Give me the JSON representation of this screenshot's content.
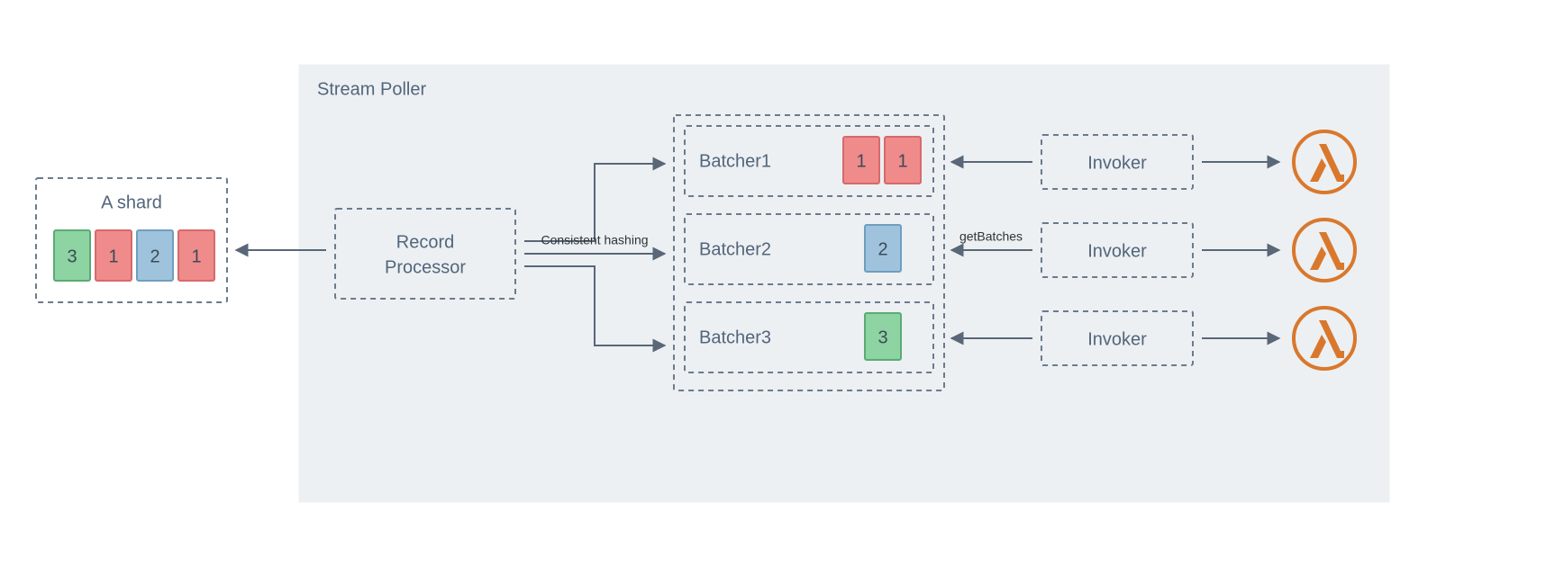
{
  "colors": {
    "dashed_stroke": "#6b7b8c",
    "poller_bg": "#ecf0f3",
    "label_text": "#53657b",
    "cell_green": "#8ed3a2",
    "cell_red": "#ef8b8b",
    "cell_blue": "#9fc3dc",
    "lambda": "#d9782d",
    "connector": "#596777"
  },
  "shard": {
    "title": "A shard",
    "cells": [
      {
        "value": "3",
        "color": "green"
      },
      {
        "value": "1",
        "color": "red"
      },
      {
        "value": "2",
        "color": "blue"
      },
      {
        "value": "1",
        "color": "red"
      }
    ]
  },
  "poller_title": "Stream Poller",
  "record_processor": {
    "line1": "Record",
    "line2": "Processor"
  },
  "edge_labels": {
    "hashing": "Consistent hashing",
    "getBatches": "getBatches"
  },
  "batchers": [
    {
      "name": "Batcher1",
      "cells": [
        {
          "value": "1",
          "color": "red"
        },
        {
          "value": "1",
          "color": "red"
        }
      ]
    },
    {
      "name": "Batcher2",
      "cells": [
        {
          "value": "2",
          "color": "blue"
        }
      ]
    },
    {
      "name": "Batcher3",
      "cells": [
        {
          "value": "3",
          "color": "green"
        }
      ]
    }
  ],
  "invoker_label": "Invoker",
  "lambda_count": 3
}
